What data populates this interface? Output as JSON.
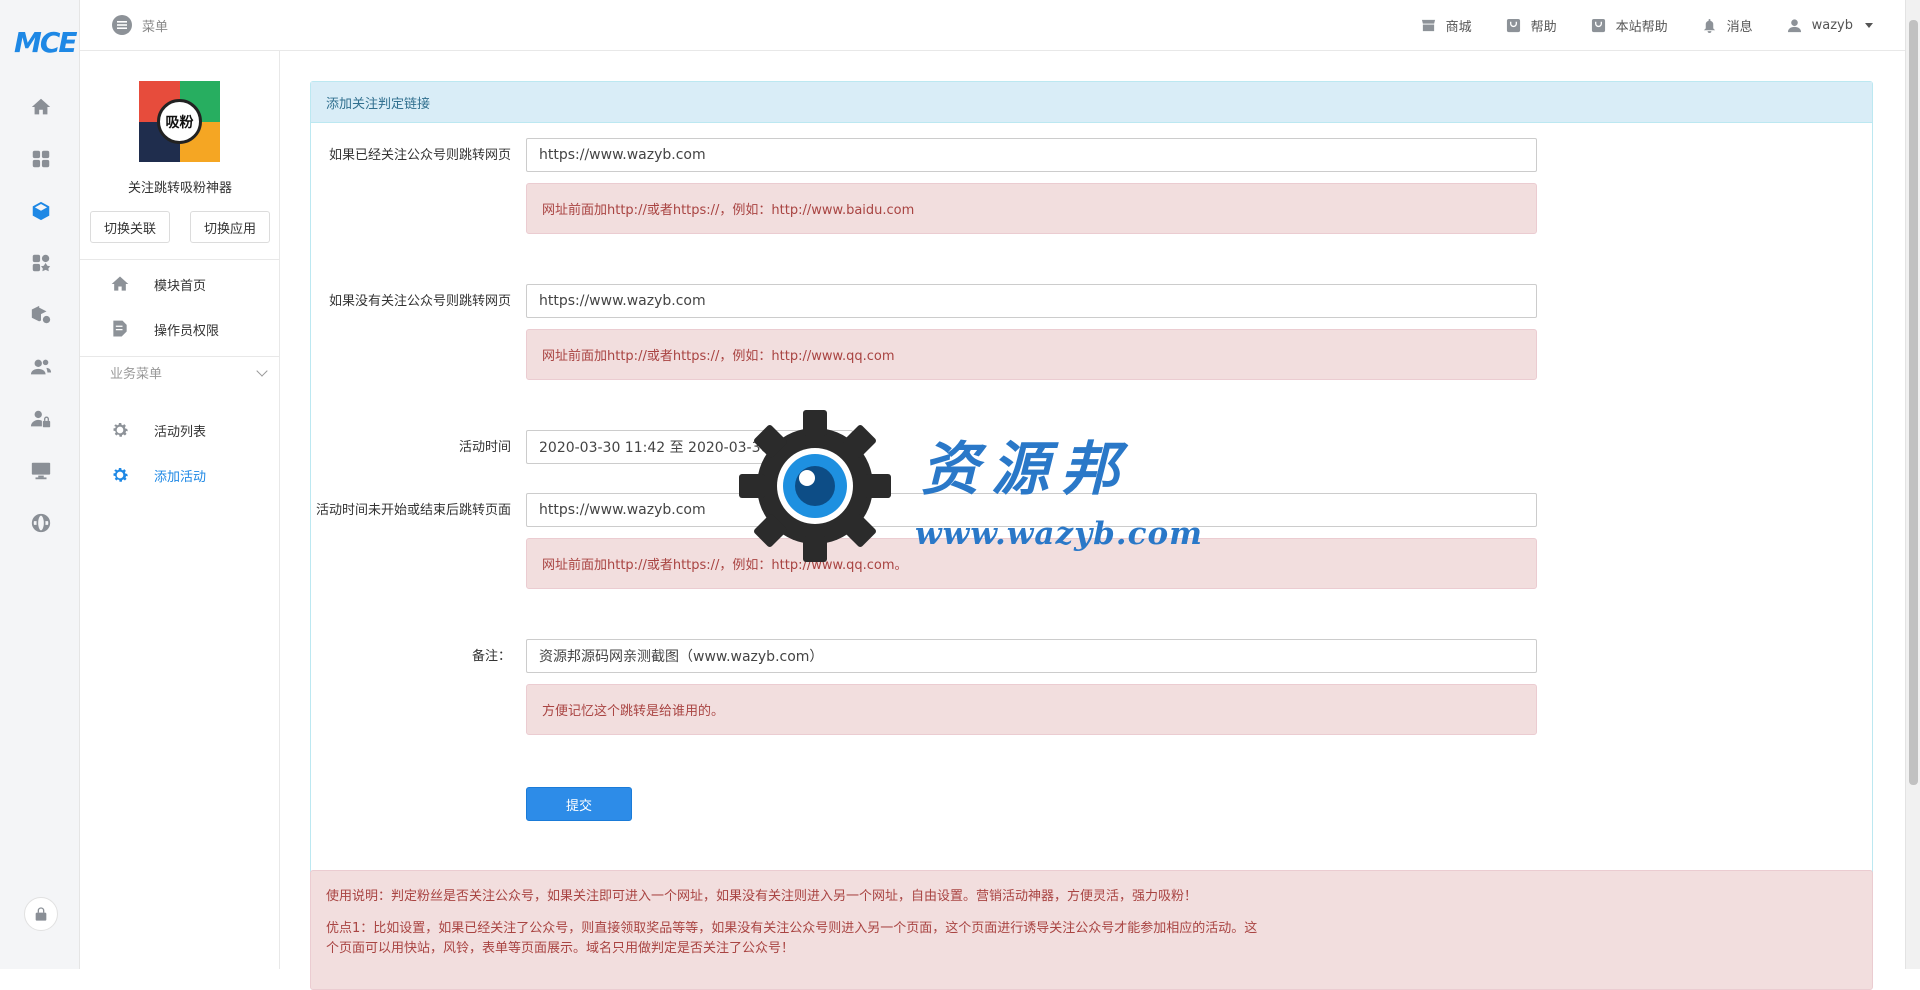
{
  "brand": {
    "logo_text": "MCE"
  },
  "topbar": {
    "menu_label": "菜单",
    "items": [
      {
        "label": "商城",
        "icon": "shop-icon"
      },
      {
        "label": "帮助",
        "icon": "help-bag-icon"
      },
      {
        "label": "本站帮助",
        "icon": "site-help-icon"
      },
      {
        "label": "消息",
        "icon": "bell-icon"
      }
    ],
    "user_name": "wazyb"
  },
  "rail_icons": [
    "home-icon",
    "dashboard-icon",
    "module-cube-icon",
    "apps-icon",
    "cube-settings-icon",
    "users-icon",
    "user-lock-icon",
    "monitor-icon",
    "globe-icon"
  ],
  "module": {
    "logo_text": "吸粉",
    "name": "关注跳转吸粉神器",
    "switch_link_label": "切换关联",
    "switch_app_label": "切换应用",
    "nav": [
      {
        "label": "模块首页",
        "icon": "home-icon"
      },
      {
        "label": "操作员权限",
        "icon": "edit-doc-icon"
      }
    ],
    "group_label": "业务菜单",
    "group_items": [
      {
        "label": "活动列表",
        "icon": "gear-icon"
      },
      {
        "label": "添加活动",
        "icon": "gear-icon",
        "active": true
      }
    ]
  },
  "form": {
    "panel_title": "添加关注判定链接",
    "fields": [
      {
        "label": "如果已经关注公众号则跳转网页",
        "value": "https://www.wazyb.com",
        "help": "网址前面加http://或者https://，例如：http://www.baidu.com"
      },
      {
        "label": "如果没有关注公众号则跳转网页",
        "value": "https://www.wazyb.com",
        "help": "网址前面加http://或者https://，例如：http://www.qq.com"
      },
      {
        "label": "活动时间",
        "value": "2020-03-30 11:42 至 2020-03-30 11:42"
      },
      {
        "label": "活动时间未开始或结束后跳转页面",
        "value": "https://www.wazyb.com",
        "help": "网址前面加http://或者https://，例如：http://www.qq.com。"
      },
      {
        "label": "备注：",
        "value": "资源邦源码网亲测截图（www.wazyb.com）",
        "help": "方便记忆这个跳转是给谁用的。"
      }
    ],
    "submit_label": "提交"
  },
  "notes": {
    "line1": "使用说明：判定粉丝是否关注公众号，如果关注即可进入一个网址，如果没有关注则进入另一个网址，自由设置。营销活动神器，方便灵活，强力吸粉！",
    "line2": "优点1：比如设置，如果已经关注了公众号，则直接领取奖品等等，如果没有关注公众号则进入另一个页面，这个页面进行诱导关注公众号才能参加相应的活动。这个页面可以用快站，风铃，表单等页面展示。域名只用做判定是否关注了公众号！"
  },
  "watermark": {
    "title": "资源邦",
    "url": "www.wazyb.com"
  },
  "colors": {
    "accent": "#1e88e5",
    "panel_head_bg": "#d9edf7",
    "help_bg": "#f2dede",
    "help_text": "#a94442"
  }
}
